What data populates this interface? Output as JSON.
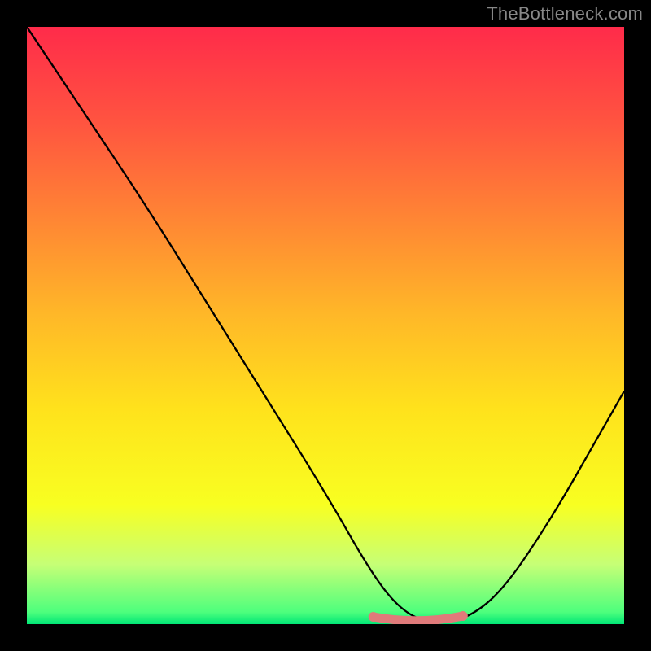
{
  "watermark": "TheBottleneck.com",
  "colors": {
    "background": "#000000",
    "top_gradient": "#ff2b4a",
    "bottom_gradient": "#00e676",
    "curve": "#000000",
    "trough_marker": "#e07a7a"
  },
  "chart_data": {
    "type": "line",
    "title": "",
    "xlabel": "",
    "ylabel": "",
    "xlim": [
      0,
      100
    ],
    "ylim": [
      0,
      100
    ],
    "grid": false,
    "legend": false,
    "series": [
      {
        "name": "bottleneck-curve",
        "x": [
          0,
          10,
          20,
          30,
          40,
          50,
          58,
          63,
          68,
          74,
          80,
          88,
          96,
          100
        ],
        "values": [
          100,
          85,
          70,
          54,
          38,
          22,
          8,
          2,
          0,
          1,
          6,
          18,
          32,
          39
        ]
      }
    ],
    "annotations": [
      {
        "name": "optimal-range-marker",
        "x_start": 58,
        "x_end": 73,
        "y": 0,
        "color": "#e07a7a"
      }
    ]
  }
}
